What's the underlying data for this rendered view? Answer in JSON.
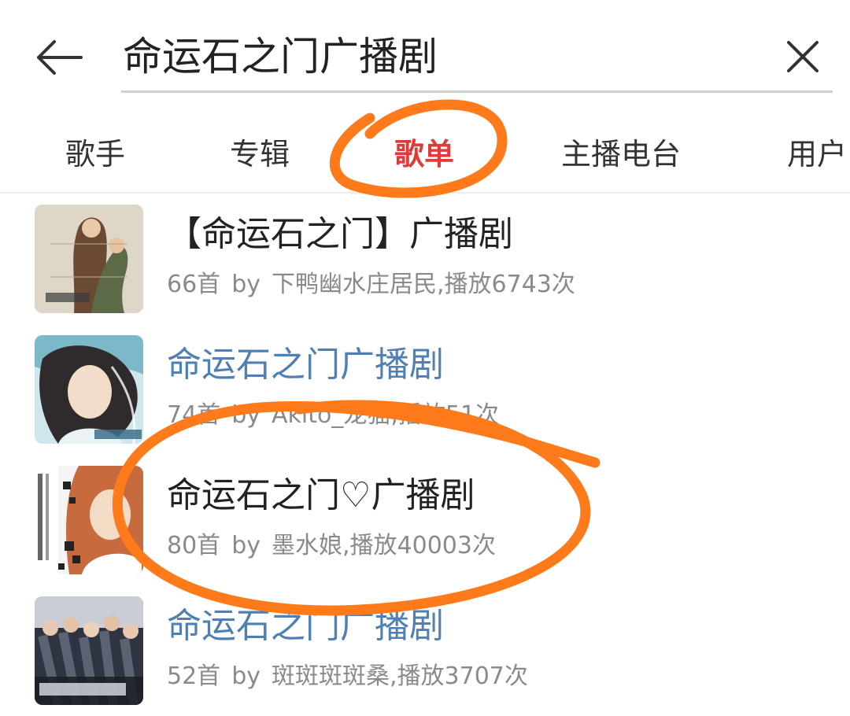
{
  "search": {
    "query": "命运石之门广播剧"
  },
  "tabs": [
    {
      "label": "歌手",
      "active": false
    },
    {
      "label": "专辑",
      "active": false
    },
    {
      "label": "歌单",
      "active": true
    },
    {
      "label": "主播电台",
      "active": false
    },
    {
      "label": "用户",
      "active": false
    }
  ],
  "playlists": [
    {
      "title": "【命运石之门】广播剧",
      "count": "66首",
      "by": "by",
      "creator": "下鸭幽水庄居民,",
      "plays": "播放6743次"
    },
    {
      "title": "命运石之门广播剧",
      "count": "74首",
      "by": "by",
      "creator": "Akito_龙猫,",
      "plays": "播放51次"
    },
    {
      "title": "命运石之门♡广播剧",
      "count": "80首",
      "by": "by",
      "creator": "墨水娘,",
      "plays": "播放40003次"
    },
    {
      "title": "命运石之门广播剧",
      "count": "52首",
      "by": "by",
      "creator": "斑斑斑斑桑,",
      "plays": "播放3707次"
    }
  ],
  "colors": {
    "accent_red": "#e03a3a",
    "link_blue": "#4f7fb3",
    "annotation_orange": "#ff7a1a"
  },
  "icons": {
    "back": "arrow-left-icon",
    "clear": "close-icon"
  }
}
